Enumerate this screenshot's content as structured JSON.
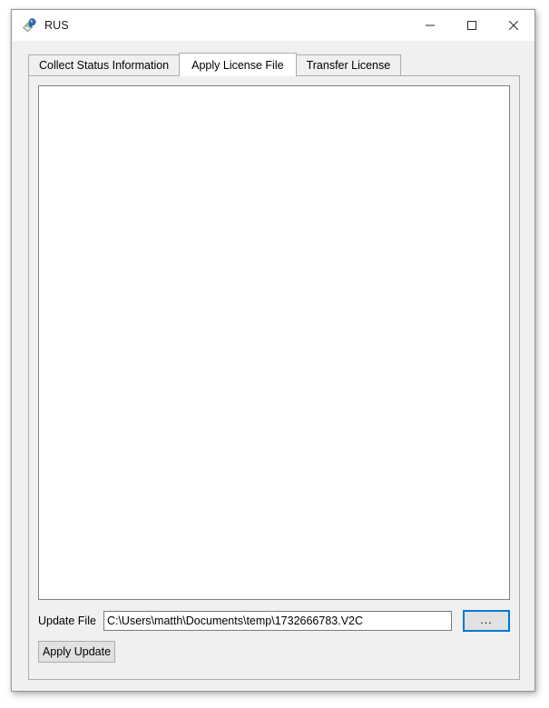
{
  "window": {
    "title": "RUS",
    "icon": "license-key-tag-icon",
    "controls": {
      "minimize": {
        "name": "minimize-button",
        "glyph": "—"
      },
      "maximize": {
        "name": "maximize-button",
        "glyph": "□"
      },
      "close": {
        "name": "close-button",
        "glyph": "✕"
      }
    }
  },
  "tabs": [
    {
      "label": "Collect Status Information",
      "selected": false
    },
    {
      "label": "Apply License File",
      "selected": true
    },
    {
      "label": "Transfer License",
      "selected": false
    }
  ],
  "main": {
    "log": {
      "value": "",
      "placeholder": ""
    },
    "update_file": {
      "label": "Update File",
      "value": "C:\\Users\\matth\\Documents\\temp\\1732666783.V2C",
      "placeholder": "",
      "browse_label": "..."
    },
    "apply_button": {
      "label": "Apply Update"
    }
  },
  "colors": {
    "window_background": "#f0f0f0",
    "titlebar_background": "#ffffff",
    "tab_border": "#acacac",
    "field_border": "#7a7a7a",
    "focus_accent": "#0078d7",
    "button_face": "#e1e1e1",
    "text": "#000000"
  }
}
